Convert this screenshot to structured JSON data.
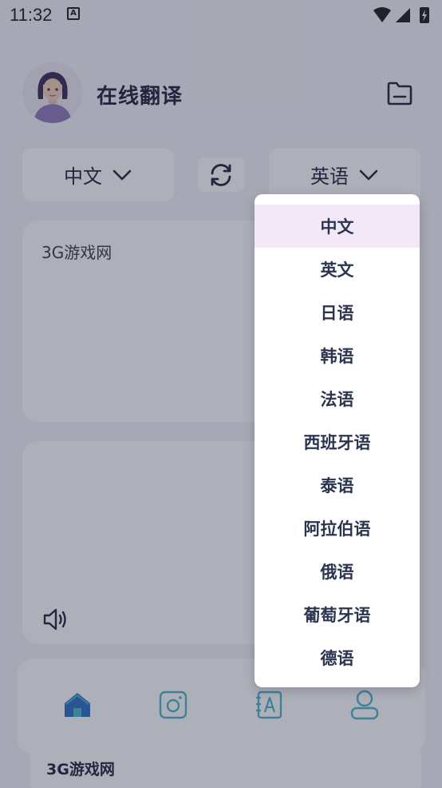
{
  "status_bar": {
    "time": "11:32",
    "notification_glyph": "A",
    "icons": [
      "wifi-icon",
      "signal-icon",
      "battery-charging-icon"
    ]
  },
  "header": {
    "title": "在线翻译",
    "avatar_icon": "avatar-icon",
    "action_icon": "folder-icon"
  },
  "language_bar": {
    "source_language": "中文",
    "target_language": "英语",
    "swap_icon": "swap-icon",
    "chevron_icon": "chevron-down-icon"
  },
  "input": {
    "text": "3G游戏网"
  },
  "output": {
    "text": "",
    "speaker_icon": "speaker-icon"
  },
  "bottom_nav": {
    "items": [
      {
        "icon": "home-icon",
        "active": true
      },
      {
        "icon": "camera-icon",
        "active": false
      },
      {
        "icon": "dictionary-icon",
        "active": false
      },
      {
        "icon": "user-icon",
        "active": false
      }
    ]
  },
  "footer": {
    "text": "3G游戏网"
  },
  "dropdown": {
    "selected_index": 0,
    "options": [
      "中文",
      "英文",
      "日语",
      "韩语",
      "法语",
      "西班牙语",
      "泰语",
      "阿拉伯语",
      "俄语",
      "葡萄牙语",
      "德语"
    ]
  },
  "colors": {
    "accent_selected_bg": "#f3e8f8",
    "nav_active": "#2a6fc2",
    "nav_inactive": "#4bb8c8",
    "text_dark": "#23233a"
  }
}
